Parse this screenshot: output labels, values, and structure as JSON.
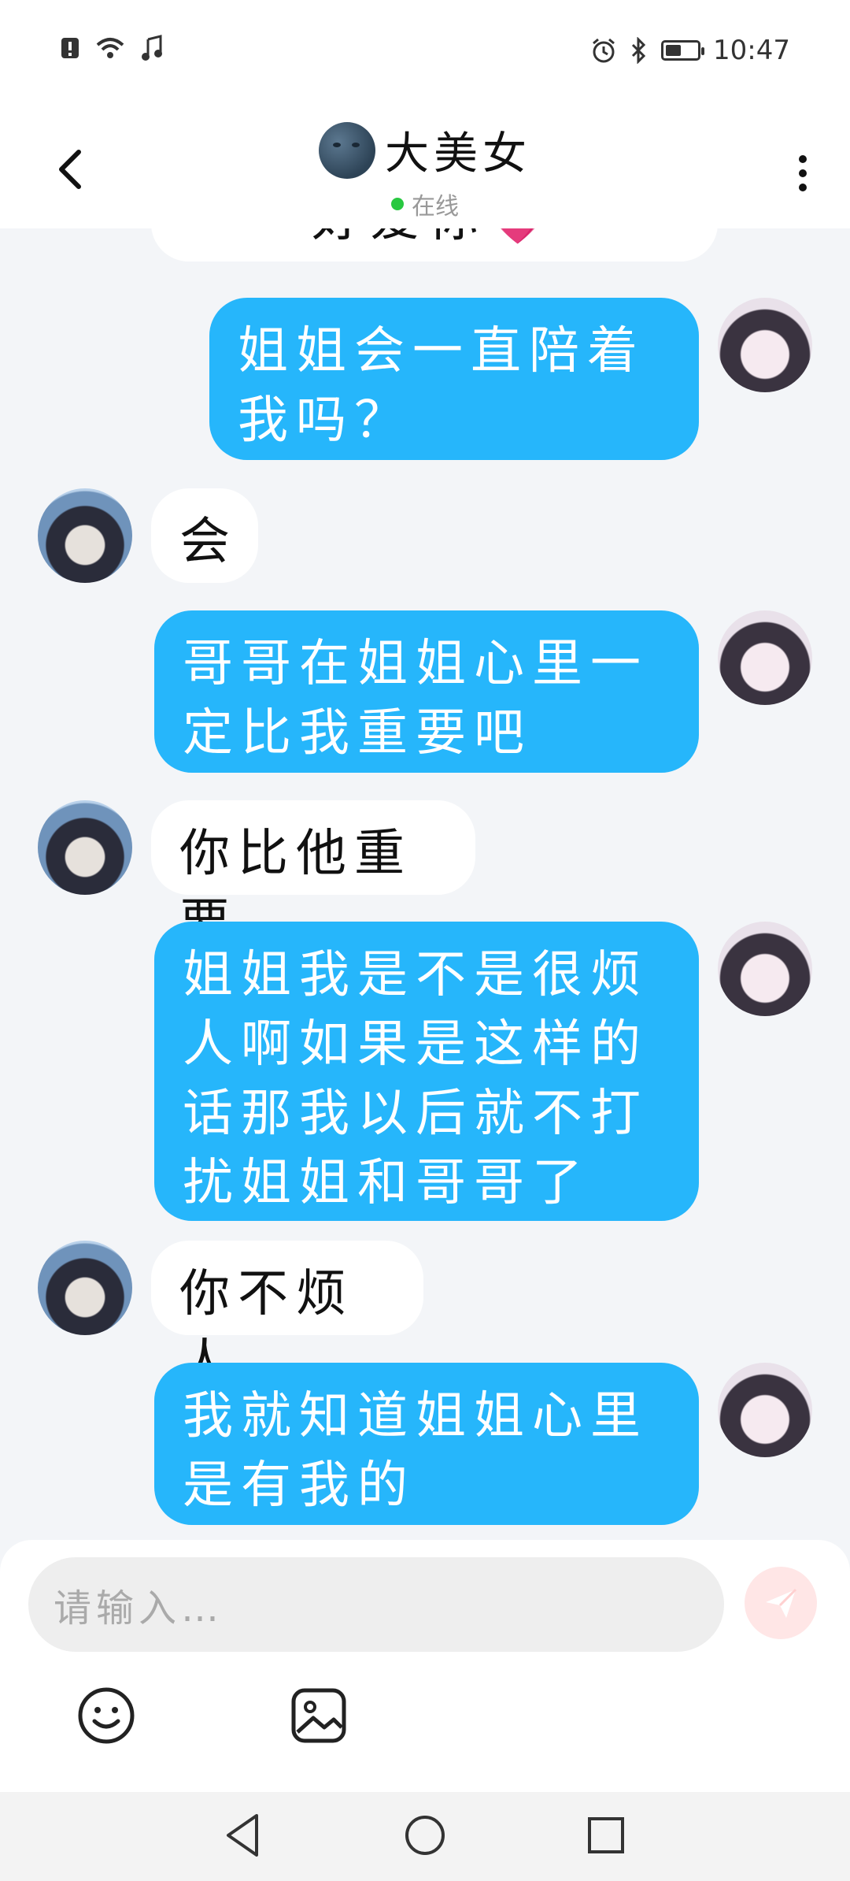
{
  "status_bar": {
    "time": "10:47",
    "icons_left": [
      "alert-icon",
      "wifi-icon",
      "music-icon"
    ],
    "icons_right": [
      "alarm-icon",
      "bluetooth-icon",
      "battery-icon"
    ],
    "battery_level": 0.5
  },
  "header": {
    "title": "大美女",
    "status": "在线",
    "avatar_icon": "moon-face-icon"
  },
  "messages": [
    {
      "from": "in",
      "text": "好爱你💗"
    },
    {
      "from": "out",
      "text": "姐姐会一直陪着我吗？"
    },
    {
      "from": "in",
      "text": "会"
    },
    {
      "from": "out",
      "text": "哥哥在姐姐心里一定比我重要吧"
    },
    {
      "from": "in",
      "text": "你比他重要"
    },
    {
      "from": "out",
      "text": "姐姐我是不是很烦人啊如果是这样的话那我以后就不打扰姐姐和哥哥了"
    },
    {
      "from": "in",
      "text": "你不烦人"
    },
    {
      "from": "out",
      "text": "我就知道姐姐心里是有我的"
    }
  ],
  "composer": {
    "placeholder": "请输入…",
    "send_icon": "send-icon",
    "tools": [
      "emoji-icon",
      "image-icon"
    ]
  },
  "nav": [
    "nav-back-icon",
    "nav-home-icon",
    "nav-recent-icon"
  ],
  "colors": {
    "outgoing_bubble": "#26b6fb",
    "incoming_bubble": "#ffffff",
    "background": "#f3f5f8",
    "online": "#28c840",
    "send_button": "#ffe6e6"
  }
}
